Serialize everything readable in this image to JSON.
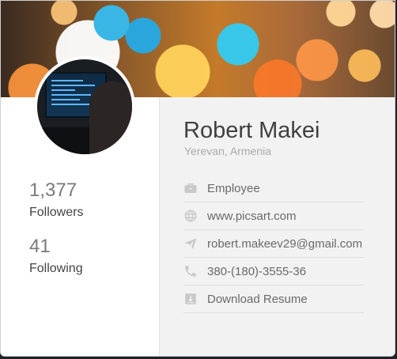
{
  "profile": {
    "name": "Robert Makei",
    "location": "Yerevan, Armenia"
  },
  "stats": {
    "followers_value": "1,377",
    "followers_label": "Followers",
    "following_value": "41",
    "following_label": "Following"
  },
  "info": [
    {
      "icon": "briefcase-icon",
      "text": "Employee"
    },
    {
      "icon": "globe-icon",
      "text": "www.picsart.com"
    },
    {
      "icon": "paper-plane-icon",
      "text": "robert.makeev29@gmail.com"
    },
    {
      "icon": "phone-icon",
      "text": "380-(180)-3555-36"
    },
    {
      "icon": "download-icon",
      "text": "Download Resume"
    }
  ],
  "colors": {
    "card_background": "#f2f2f2",
    "left_column": "#ffffff",
    "name_text": "#3f3f3f",
    "muted_text": "#aaaaaa"
  }
}
